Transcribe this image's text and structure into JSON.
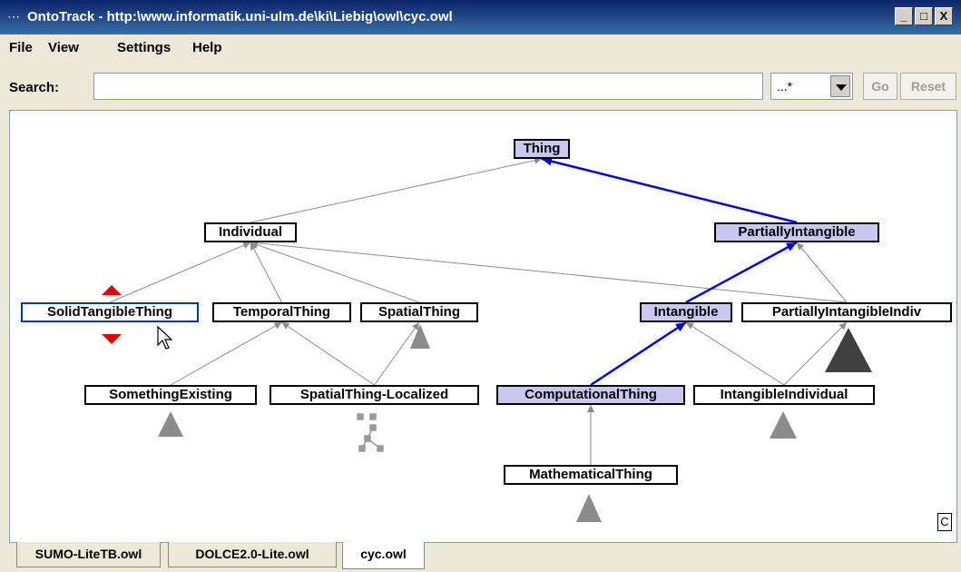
{
  "window": {
    "title": "OntoTrack - http:\\www.informatik.uni-ulm.de\\ki\\Liebig\\owl\\cyc.owl",
    "app_icon": "ontotrack-icon",
    "minimize": "_",
    "maximize": "□",
    "close": "X"
  },
  "menu": [
    "File",
    "View",
    "Settings",
    "Help"
  ],
  "search": {
    "label": "Search:",
    "value": "",
    "placeholder": "",
    "mode": "...*",
    "go_label": "Go",
    "reset_label": "Reset"
  },
  "graph": {
    "nodes": [
      {
        "id": "thing",
        "label": "Thing",
        "highlight": true
      },
      {
        "id": "individual",
        "label": "Individual",
        "highlight": false
      },
      {
        "id": "partially-intangible",
        "label": "PartiallyIntangible",
        "highlight": true
      },
      {
        "id": "solid-tangible-thing",
        "label": "SolidTangibleThing",
        "highlight": false,
        "selected": true
      },
      {
        "id": "temporal-thing",
        "label": "TemporalThing",
        "highlight": false
      },
      {
        "id": "spatial-thing",
        "label": "SpatialThing",
        "highlight": false
      },
      {
        "id": "intangible",
        "label": "Intangible",
        "highlight": true
      },
      {
        "id": "partially-intangible-indiv",
        "label": "PartiallyIntangibleIndiv",
        "highlight": false
      },
      {
        "id": "something-existing",
        "label": "SomethingExisting",
        "highlight": false
      },
      {
        "id": "spatial-thing-localized",
        "label": "SpatialThing-Localized",
        "highlight": false
      },
      {
        "id": "computational-thing",
        "label": "ComputationalThing",
        "highlight": true
      },
      {
        "id": "intangible-individual",
        "label": "IntangibleIndividual",
        "highlight": false
      },
      {
        "id": "mathematical-thing",
        "label": "MathematicalThing",
        "highlight": false
      }
    ],
    "edges": [
      {
        "from": "individual",
        "to": "thing",
        "path": false
      },
      {
        "from": "partially-intangible",
        "to": "thing",
        "path": true
      },
      {
        "from": "solid-tangible-thing",
        "to": "individual",
        "path": false
      },
      {
        "from": "temporal-thing",
        "to": "individual",
        "path": false
      },
      {
        "from": "spatial-thing",
        "to": "individual",
        "path": false
      },
      {
        "from": "partially-intangible-indiv",
        "to": "individual",
        "path": false
      },
      {
        "from": "intangible",
        "to": "partially-intangible",
        "path": true
      },
      {
        "from": "partially-intangible-indiv",
        "to": "partially-intangible",
        "path": false
      },
      {
        "from": "something-existing",
        "to": "temporal-thing",
        "path": false
      },
      {
        "from": "spatial-thing-localized",
        "to": "temporal-thing",
        "path": false
      },
      {
        "from": "spatial-thing-localized",
        "to": "spatial-thing",
        "path": false
      },
      {
        "from": "computational-thing",
        "to": "intangible",
        "path": true
      },
      {
        "from": "intangible-individual",
        "to": "intangible",
        "path": false
      },
      {
        "from": "intangible-individual",
        "to": "partially-intangible-indiv",
        "path": false
      },
      {
        "from": "mathematical-thing",
        "to": "computational-thing",
        "path": false
      }
    ],
    "colors": {
      "highlight_fill": "#c8c8f0",
      "path_edge": "#0000e0",
      "edge": "#8c8c8c",
      "expander": "#808080",
      "selection": "#0033cc",
      "reorder_arrows": "#e00000"
    }
  },
  "corner_button": "C",
  "tabs": [
    {
      "label": "SUMO-LiteTB.owl",
      "active": false
    },
    {
      "label": "DOLCE2.0-Lite.owl",
      "active": false
    },
    {
      "label": "cyc.owl",
      "active": true
    }
  ]
}
